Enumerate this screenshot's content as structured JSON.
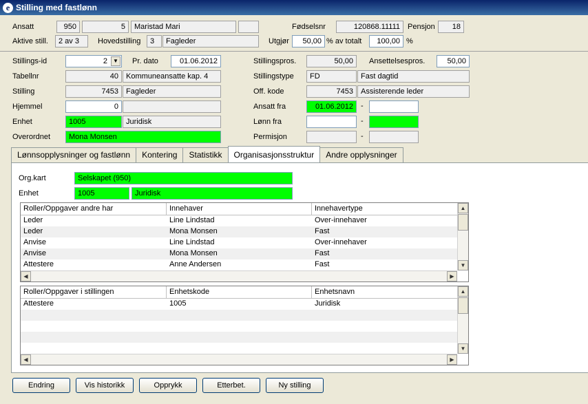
{
  "window": {
    "title": "Stilling med fastlønn",
    "icon": "e"
  },
  "header": {
    "ansatt_label": "Ansatt",
    "ansatt_nr": "950",
    "ansatt_sub": "5",
    "ansatt_navn": "Maristad Mari",
    "fodselsnr_label": "Fødselsnr",
    "fodselsnr": "120868.11111",
    "pensjon_label": "Pensjon",
    "pensjon": "18",
    "aktive_label": "Aktive still.",
    "aktive_value": "2 av 3",
    "hovedstilling_label": "Hovedstilling",
    "hovedstilling_nr": "3",
    "hovedstilling_navn": "Fagleder",
    "utgjor_label": "Utgjør",
    "utgjor_value": "50,00",
    "av_totalt_label": "% av totalt",
    "totalt_value": "100,00",
    "pct_label": "%"
  },
  "form": {
    "stillingsid_label": "Stillings-id",
    "stillingsid": "2",
    "prdato_label": "Pr. dato",
    "prdato": "01.06.2012",
    "tabellnr_label": "Tabellnr",
    "tabellnr": "40",
    "tabellnr_text": "Kommuneansatte kap. 4",
    "stilling_label": "Stilling",
    "stilling_nr": "7453",
    "stilling_text": "Fagleder",
    "hjemmel_label": "Hjemmel",
    "hjemmel": "0",
    "enhet_label": "Enhet",
    "enhet_nr": "1005",
    "enhet_text": "Juridisk",
    "overordnet_label": "Overordnet",
    "overordnet": "Mona Monsen",
    "stillingspros_label": "Stillingspros.",
    "stillingspros": "50,00",
    "ansettelsespros_label": "Ansettelsespros.",
    "ansettelsespros": "50,00",
    "stillingstype_label": "Stillingstype",
    "stillingstype": "FD",
    "stillingstype_text": "Fast dagtid",
    "offkode_label": "Off. kode",
    "offkode": "7453",
    "offkode_text": "Assisterende leder",
    "ansattfra_label": "Ansatt fra",
    "ansattfra": "01.06.2012",
    "lonnfra_label": "Lønn fra",
    "permisjon_label": "Permisjon",
    "dash": "-"
  },
  "tabs": [
    {
      "label": "Lønnsopplysninger og fastlønn"
    },
    {
      "label": "Kontering"
    },
    {
      "label": "Statistikk"
    },
    {
      "label": "Organisasjonsstruktur"
    },
    {
      "label": "Andre opplysninger"
    }
  ],
  "org": {
    "orgkart_label": "Org.kart",
    "orgkart_value": "Selskapet (950)",
    "enhet_label": "Enhet",
    "enhet_nr": "1005",
    "enhet_text": "Juridisk"
  },
  "grid1": {
    "columns": [
      "Roller/Oppgaver andre har",
      "Innehaver",
      "Innehavertype"
    ],
    "rows": [
      [
        "Leder",
        "Line Lindstad",
        "Over-innehaver"
      ],
      [
        "Leder",
        "Mona Monsen",
        "Fast"
      ],
      [
        "Anvise",
        "Line Lindstad",
        "Over-innehaver"
      ],
      [
        "Anvise",
        "Mona Monsen",
        "Fast"
      ],
      [
        "Attestere",
        "Anne Andersen",
        "Fast"
      ]
    ]
  },
  "grid2": {
    "columns": [
      "Roller/Oppgaver i stillingen",
      "Enhetskode",
      "Enhetsnavn"
    ],
    "rows": [
      [
        "Attestere",
        "1005",
        "Juridisk"
      ]
    ]
  },
  "buttons": {
    "endring": "Endring",
    "historikk": "Vis historikk",
    "opprykk": "Opprykk",
    "etterbet": "Etterbet.",
    "ny_stilling": "Ny stilling"
  }
}
